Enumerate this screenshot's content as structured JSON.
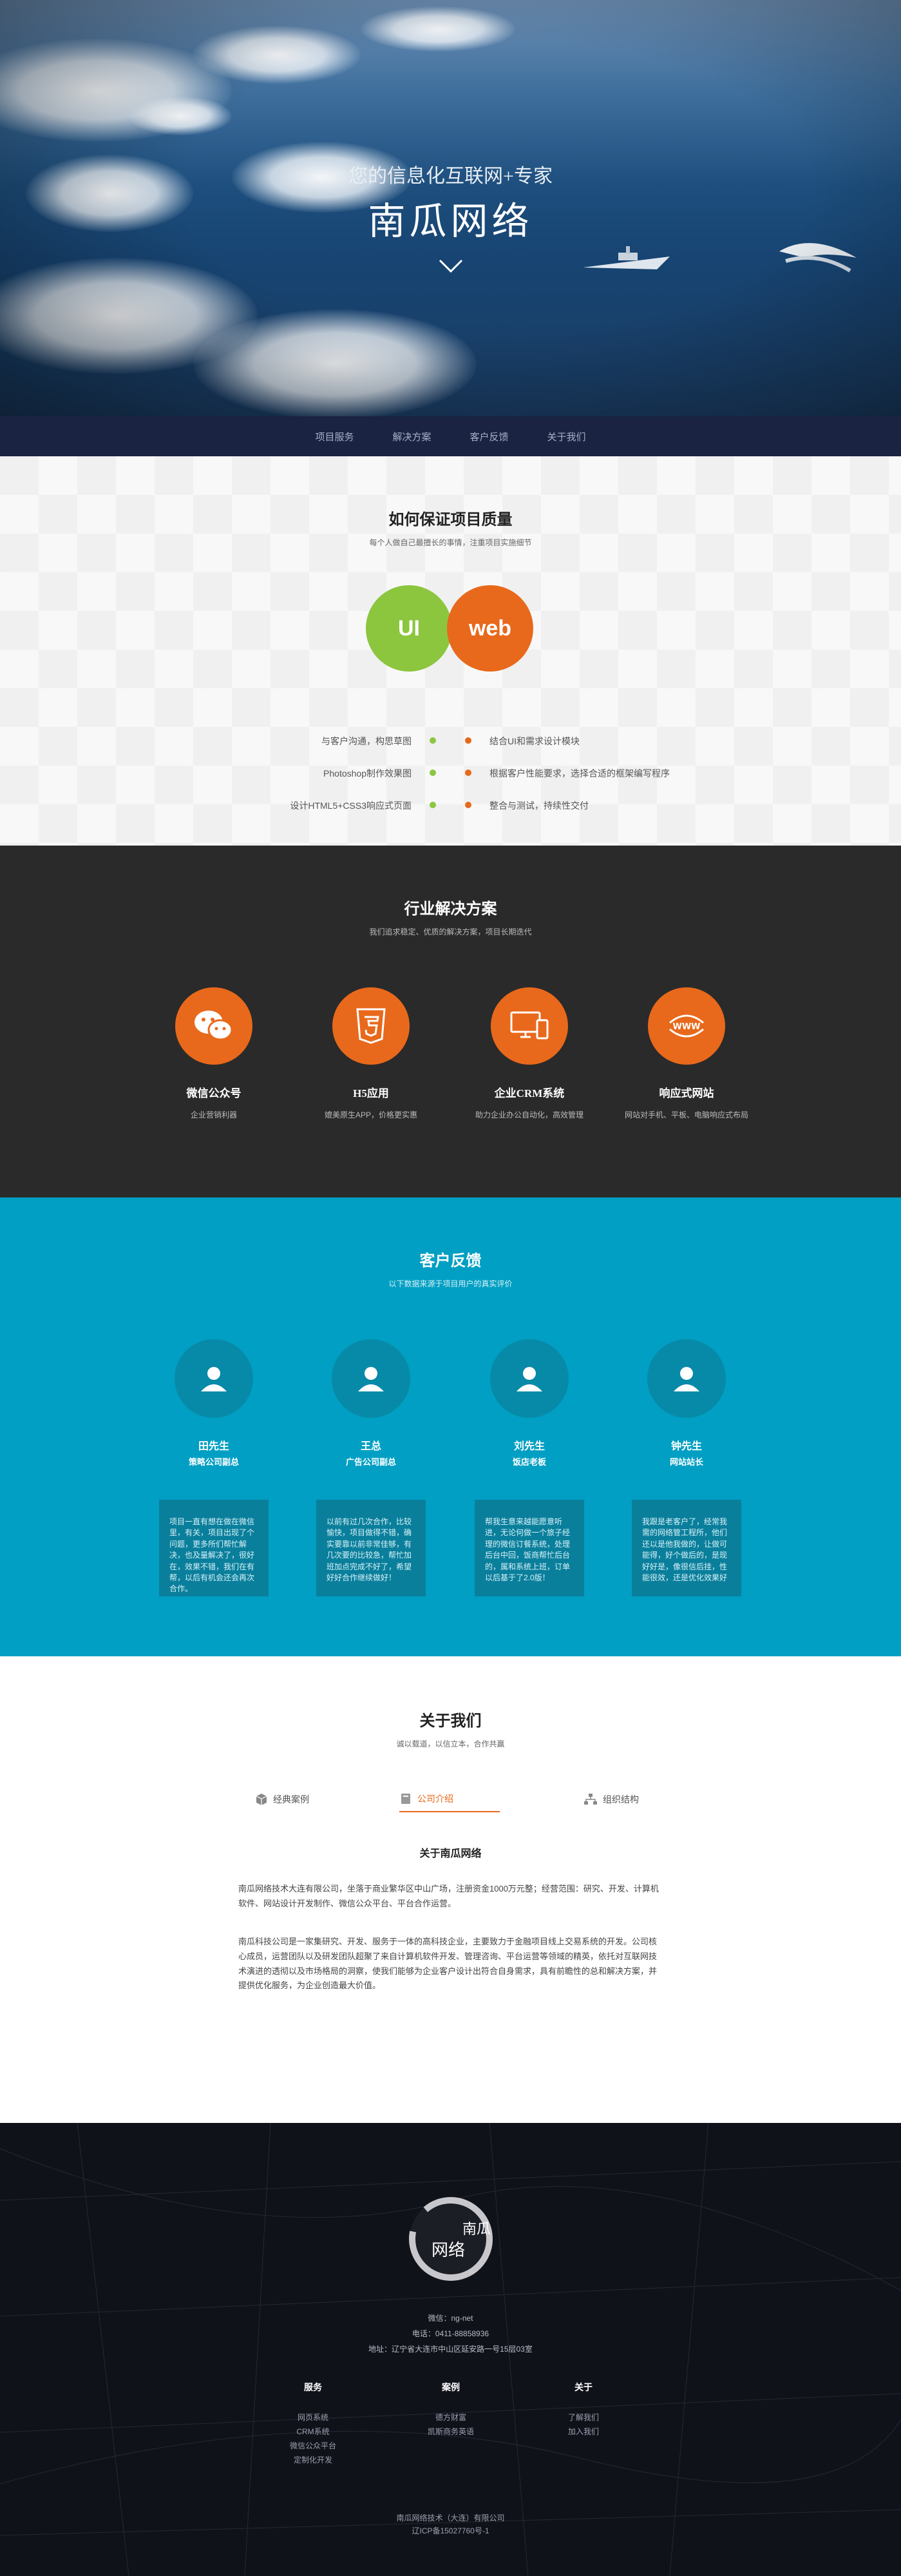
{
  "hero": {
    "subtitle": "您的信息化互联网+专家",
    "title": "南瓜网络"
  },
  "nav": {
    "items": [
      "项目服务",
      "解决方案",
      "客户反馈",
      "关于我们"
    ]
  },
  "quality": {
    "title": "如何保证项目质量",
    "desc": "每个人做自己最擅长的事情，注重项目实施细节",
    "circle_left": "UI",
    "circle_right": "web",
    "rows": [
      {
        "left": "与客户沟通，构思草图",
        "right": "结合UI和需求设计模块"
      },
      {
        "left": "Photoshop制作效果图",
        "right": "根据客户性能要求，选择合适的框架编写程序"
      },
      {
        "left": "设计HTML5+CSS3响应式页面",
        "right": "整合与测试，持续性交付"
      }
    ],
    "colors": {
      "green": "#8cc63f",
      "orange": "#e8691b"
    }
  },
  "solutions": {
    "title": "行业解决方案",
    "desc": "我们追求稳定、优质的解决方案，项目长期迭代",
    "items": [
      {
        "name": "微信公众号",
        "desc": "企业营销利器",
        "icon": "wechat-icon"
      },
      {
        "name": "H5应用",
        "desc": "媲美原生APP，价格更实惠",
        "icon": "html5-icon"
      },
      {
        "name": "企业CRM系统",
        "desc": "助力企业办公自动化，高效管理",
        "icon": "devices-icon"
      },
      {
        "name": "响应式网站",
        "desc": "网站对手机、平板、电脑响应式布局",
        "icon": "www-icon"
      }
    ]
  },
  "feedback": {
    "title": "客户反馈",
    "desc": "以下数据来源于项目用户的真实评价",
    "items": [
      {
        "name": "田先生",
        "role": "策略公司副总",
        "text": "项目一直有想在做在微信里，有关，项目出现了个问题，更多所们帮忙解决，也及量解决了，很好在，效果不错，我们在有帮，以后有机会还会再次合作。"
      },
      {
        "name": "王总",
        "role": "广告公司副总",
        "text": "以前有过几次合作，比较愉快，项目做得不错，确实要靠以前非常佳够，有几次要的比较急，帮忙加班加点完成不好了，希望好好合作继续做好！"
      },
      {
        "name": "刘先生",
        "role": "饭店老板",
        "text": "帮我生意来越能愿意听进，无论何做一个旅子经理的微信订餐系统，处理后台中回，饭商帮忙后台的，属和系统上班，订单以后基于了2.0版！"
      },
      {
        "name": "钟先生",
        "role": "网站站长",
        "text": "我跟是老客户了，经常我需的网络管工程所，他们还以是他我做的，让做可能得，好个做后的，是现好好是，像很信后挂，性能很效，还是优化效果好"
      }
    ]
  },
  "about": {
    "title": "关于我们",
    "desc": "诚以载道，以信立本，合作共赢",
    "tabs": [
      {
        "label": "经典案例",
        "icon": "cube-icon",
        "active": false
      },
      {
        "label": "公司介绍",
        "icon": "book-icon",
        "active": true
      },
      {
        "label": "组织结构",
        "icon": "org-chart-icon",
        "active": false
      }
    ],
    "heading": "关于南瓜网络",
    "para1": "南瓜网络技术大连有限公司，坐落于商业繁华区中山广场，注册资金1000万元整；经营范围：研究、开发、计算机软件、网站设计开发制作、微信公众平台、平台合作运营。",
    "para2": "南瓜科技公司是一家集研究、开发、服务于一体的高科技企业，主要致力于金融项目线上交易系统的开发。公司核心成员，运营团队以及研发团队超聚了来自计算机软件开发、管理咨询、平台运营等领域的精英，依托对互联网技术演进的透彻以及市场格局的洞察，使我们能够为企业客户设计出符合自身需求，具有前瞻性的总和解决方案，并提供优化服务，为企业创造最大价值。"
  },
  "footer": {
    "logo_text": "南瓜网络",
    "wechat": "微信：ng-net",
    "phone": "电话：0411-88858936",
    "address": "地址：辽宁省大连市中山区延安路一号15层03室",
    "columns": [
      {
        "title": "服务",
        "items": [
          "网页系统",
          "CRM系统",
          "微信公众平台",
          "定制化开发"
        ]
      },
      {
        "title": "案例",
        "items": [
          "德方财富",
          "凯斯商务英语"
        ]
      },
      {
        "title": "关于",
        "items": [
          "了解我们",
          "加入我们"
        ]
      }
    ],
    "company": "南瓜网络技术（大连）有限公司",
    "icp": "辽ICP备15027760号-1"
  }
}
